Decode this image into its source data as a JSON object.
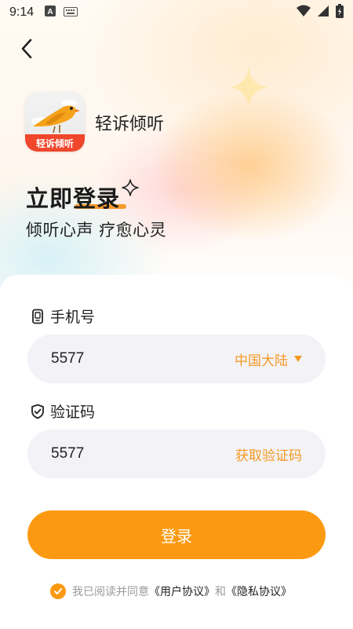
{
  "status_bar": {
    "time": "9:14",
    "left_icons": [
      "a-input-icon",
      "keyboard-icon"
    ],
    "right_icons": [
      "wifi-icon",
      "signal-icon",
      "battery-icon"
    ]
  },
  "header": {
    "back_icon": "chevron-left-icon"
  },
  "app": {
    "logo_text": "轻诉倾听",
    "name": "轻诉倾听"
  },
  "hero": {
    "title": "立即登录",
    "subtitle": "倾听心声 疗愈心灵"
  },
  "form": {
    "phone": {
      "label": "手机号",
      "value": "5577",
      "region": "中国大陆"
    },
    "code": {
      "label": "验证码",
      "value": "5577",
      "get_code": "获取验证码"
    },
    "login_button": "登录"
  },
  "agreement": {
    "checked": true,
    "prefix": "我已阅读并同意",
    "user_agreement": "《用户协议》",
    "conjunction": "和",
    "privacy_policy": "《隐私协议》"
  },
  "colors": {
    "accent": "#fb9a12",
    "accent_text": "#f59a23",
    "input_bg": "#f3f2f7",
    "text": "#222222",
    "muted": "#9a9a9a"
  }
}
